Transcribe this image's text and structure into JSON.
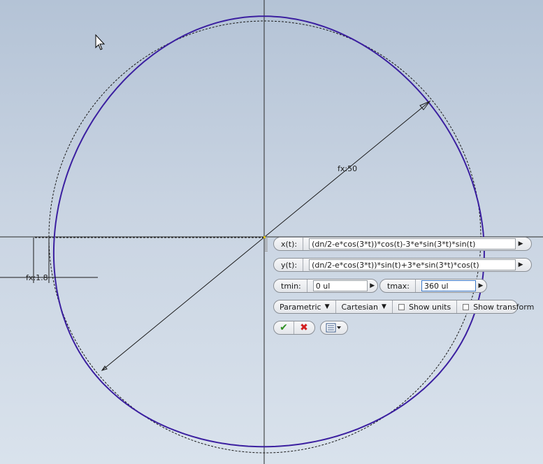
{
  "canvas": {
    "dimension_diameter": "fx:50",
    "dimension_small": "fx:1.8"
  },
  "dialog": {
    "x_label": "x(t):",
    "x_value": "(dn/2-e*cos(3*t))*cos(t)-3*e*sin(3*t)*sin(t)",
    "y_label": "y(t):",
    "y_value": "(dn/2-e*cos(3*t))*sin(t)+3*e*sin(3*t)*cos(t)",
    "tmin_label": "tmin:",
    "tmin_value": "0 ul",
    "tmax_label": "tmax:",
    "tmax_value": "360 ul",
    "mode": "Parametric",
    "coords": "Cartesian",
    "show_units": "Show units",
    "show_transform": "Show transform"
  },
  "colors": {
    "curve": "#3b1fa0",
    "ok": "#2f8f22",
    "cancel": "#d21f1f"
  },
  "icons": {
    "cursor": "mouse-pointer-icon",
    "ok": "checkmark-icon",
    "cancel": "x-icon",
    "options": "list-options-icon"
  }
}
